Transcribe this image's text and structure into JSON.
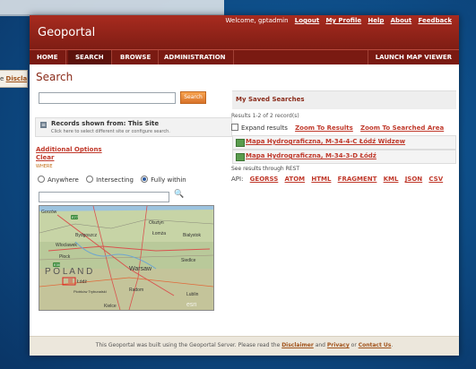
{
  "background_fragments": {
    "left_text": "e ",
    "left_link": "Discla"
  },
  "header": {
    "title": "Geoportal",
    "welcome": "Welcome, gptadmin",
    "links": [
      "Logout",
      "My Profile",
      "Help",
      "About",
      "Feedback"
    ]
  },
  "nav": {
    "items": [
      "HOME",
      "SEARCH",
      "BROWSE",
      "ADMINISTRATION"
    ],
    "active": "SEARCH",
    "launch": "LAUNCH MAP VIEWER"
  },
  "search": {
    "page_title": "Search",
    "query_value": "",
    "button_label": "Search",
    "records_title": "Records shown from: This Site",
    "records_hint": "Click here to select different site or configure search.",
    "advanced_options": "Additional Options",
    "clear": "Clear",
    "where_label": "WHERE",
    "where_options": [
      "Anywhere",
      "Intersecting",
      "Fully within"
    ],
    "where_selected": "Fully within",
    "place_value": ""
  },
  "map": {
    "labels": {
      "gorzow": "Gorzów",
      "bydgoszcz": "Bydgoszcz",
      "olsztyn": "Olsztyn",
      "lomza": "Łomża",
      "bialystok": "Bialystok",
      "wloclawek": "Wloclawek",
      "plock": "Płock",
      "siedlce": "Siedlce",
      "poland": "P O L A N D",
      "warsaw": "Warsaw",
      "lodz": "Łódź",
      "piotrkow": "Piotrków Trybunalski",
      "radom": "Radom",
      "lublin": "Lublin",
      "kielce": "Kielce",
      "esri": "esri",
      "road_e77": "E77",
      "road_e30": "E30"
    }
  },
  "saved": {
    "header": "My Saved Searches",
    "results_count": "Results 1-2 of 2 record(s)",
    "expand_label": "Expand results",
    "zoom_results": "Zoom To Results",
    "zoom_searched": "Zoom To Searched Area",
    "items": [
      "Mapa Hydrograficzna, M-34-4-C Łódź Widzew",
      "Mapa Hydrograficzna, M-34-3-D Łódź"
    ],
    "rest_label": "See results through REST",
    "api_label": "API:",
    "api_links": [
      "GEORSS",
      "ATOM",
      "HTML",
      "FRAGMENT",
      "KML",
      "JSON",
      "CSV"
    ]
  },
  "footer": {
    "text1": "This Geoportal was built using the Geoportal Server. Please read the ",
    "disclaimer": "Disclaimer",
    "and": " and ",
    "privacy": "Privacy",
    "or": " or ",
    "contact": "Contact Us",
    "end": "."
  },
  "colors": {
    "header_red": "#a82b1f",
    "nav_dark": "#7a1a12",
    "accent_orange": "#e58a3a",
    "link_red": "#c0392b",
    "title_red": "#8a2b1a"
  }
}
